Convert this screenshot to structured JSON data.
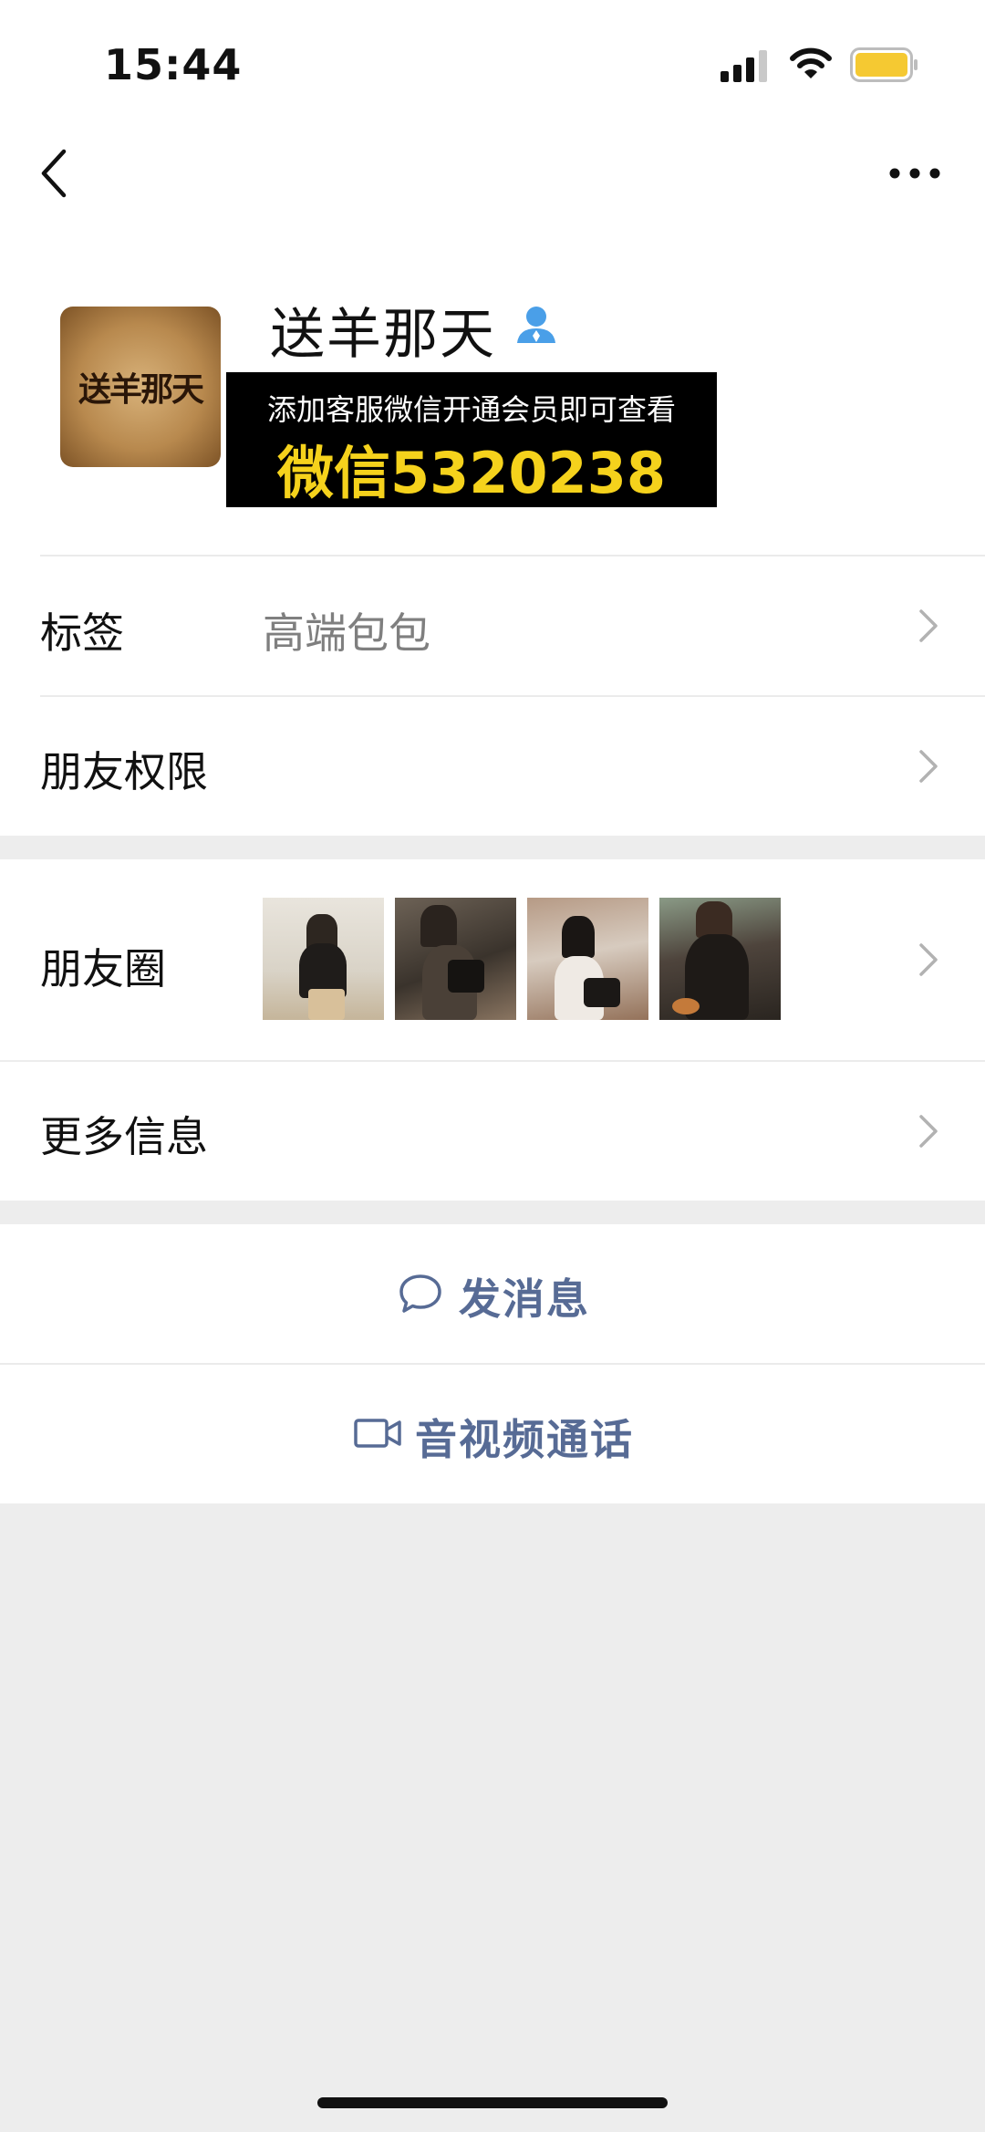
{
  "status_bar": {
    "time": "15:44"
  },
  "profile": {
    "name": "送羊那天",
    "avatar_text": "送羊那天",
    "promo_line1": "添加客服微信开通会员即可查看",
    "promo_line2": "微信5320238"
  },
  "rows": {
    "tags_label": "标签",
    "tags_value": "高端包包",
    "permissions_label": "朋友权限",
    "moments_label": "朋友圈",
    "more_info_label": "更多信息"
  },
  "actions": {
    "message_label": "发消息",
    "call_label": "音视频通话"
  },
  "colors": {
    "link_blue": "#576b95",
    "promo_yellow": "#f5d21c",
    "battery_yellow": "#f5c932",
    "verified_blue": "#4a9fe8"
  }
}
